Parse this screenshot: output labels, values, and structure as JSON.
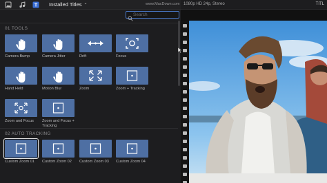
{
  "toolbar": {
    "title": "Installed Titles",
    "icons": [
      "photos-icon",
      "music-icon",
      "titles-icon"
    ]
  },
  "search": {
    "placeholder": "Search",
    "value": ""
  },
  "watermark": "www.MacDown.com",
  "sections": [
    {
      "header": "01 TOOLS",
      "items": [
        {
          "label": "Camera Bump",
          "icon": "hand-icon"
        },
        {
          "label": "Camera Jitter",
          "icon": "hand-icon"
        },
        {
          "label": "Drift",
          "icon": "drift-arrows-icon"
        },
        {
          "label": "Focus",
          "icon": "focus-icon"
        },
        {
          "label": "Hand Held",
          "icon": "hand-icon"
        },
        {
          "label": "Motion Blur",
          "icon": "hand-icon"
        },
        {
          "label": "Zoom",
          "icon": "zoom-icon"
        },
        {
          "label": "Zoom + Tracking",
          "icon": "tracking-target-icon"
        },
        {
          "label": "Zoom and Focus",
          "icon": "zoom-focus-icon"
        },
        {
          "label": "Zoom and Focus + Tracking",
          "icon": "tracking-target-icon"
        }
      ]
    },
    {
      "header": "02 AUTO TRACKING",
      "items": [
        {
          "label": "Custom Zoom 01",
          "icon": "tracking-target-icon",
          "selected": true
        },
        {
          "label": "Custom Zoom 02",
          "icon": "tracking-target-icon"
        },
        {
          "label": "Custom Zoom 03",
          "icon": "tracking-target-icon"
        },
        {
          "label": "Custom Zoom 04",
          "icon": "tracking-target-icon"
        }
      ]
    }
  ],
  "viewer": {
    "format": "1080p HD 24p, Stereo",
    "clip_name": "TITL"
  },
  "colors": {
    "tile": "#4e6fa3",
    "accent": "#4a78c9",
    "panel": "#1d1d1f"
  }
}
